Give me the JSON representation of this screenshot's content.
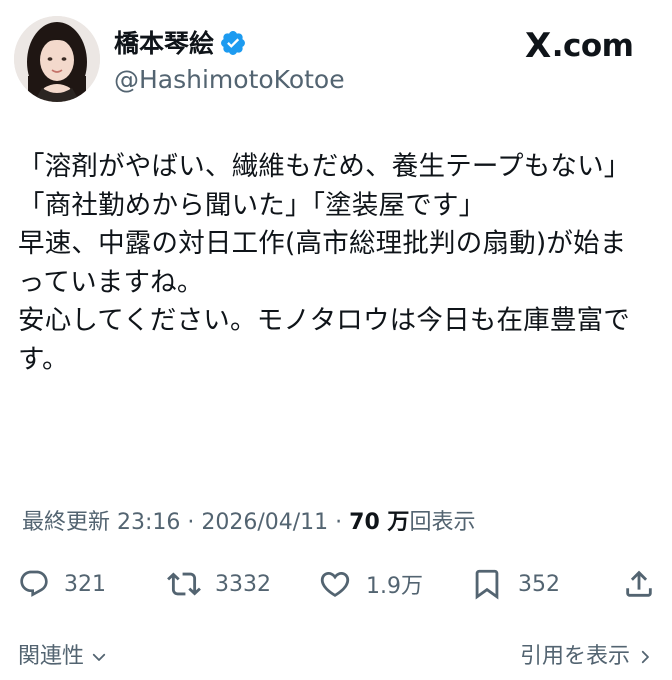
{
  "author": {
    "display_name": "橋本琴絵",
    "handle": "@HashimotoKotoe",
    "verified": true
  },
  "brand": {
    "logo_text": ".com",
    "logo_mark": "X"
  },
  "tweet": {
    "lines": [
      "「溶剤がやばい、繊維もだめ、養生テープもない」",
      "「商社勤めから聞いた」「塗装屋です」",
      "早速、中露の対日工作(高市総理批判の扇動)が始まっていますね。",
      "安心してください。モノタロウは今日も在庫豊富です。"
    ]
  },
  "meta": {
    "prefix": "最終更新 23:16 · 2026/04/11 · ",
    "views_count": "70 万",
    "views_label": "回表示"
  },
  "actions": {
    "replies": "321",
    "reposts": "3332",
    "likes": "1.9万",
    "bookmarks": "352"
  },
  "footer": {
    "related_label": "関連性",
    "quotes_label": "引用を表示"
  },
  "colors": {
    "text": "#0f1419",
    "secondary": "#536471",
    "verified_blue": "#1d9bf0"
  }
}
